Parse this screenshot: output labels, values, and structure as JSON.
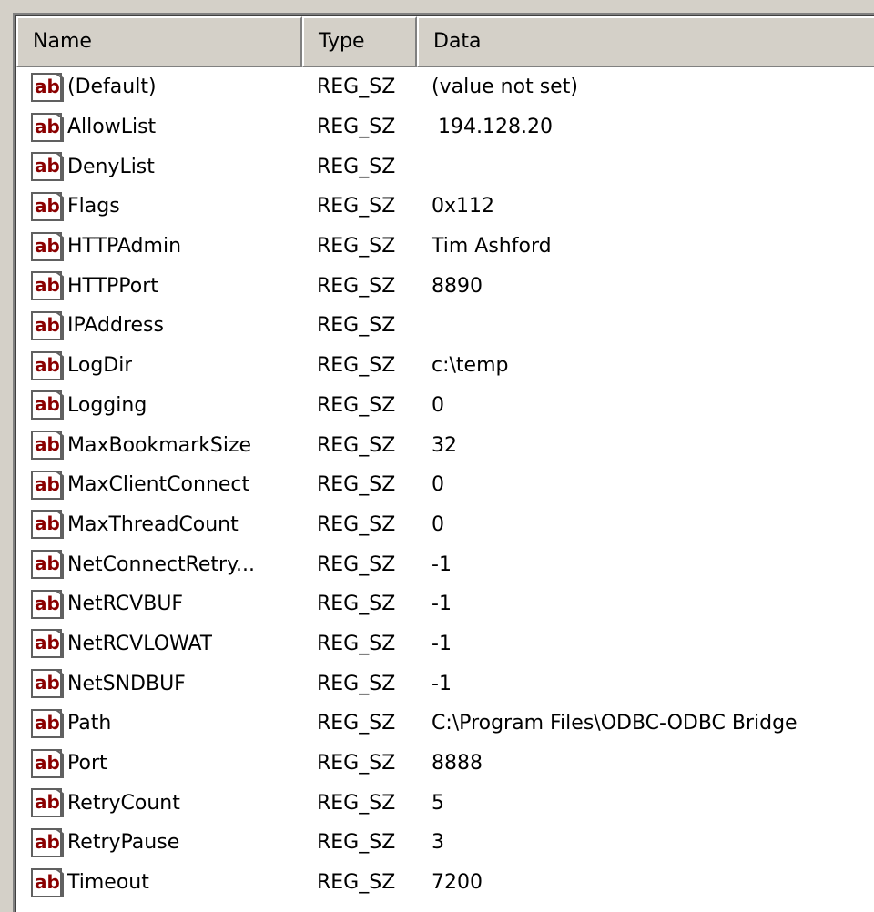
{
  "columns": {
    "name": "Name",
    "type": "Type",
    "data": "Data"
  },
  "icon": "string-value-ab-icon",
  "colors": {
    "icon_text": "#8b0000",
    "icon_border": "#606060",
    "header_bg": "#d4d0c8"
  },
  "rows": [
    {
      "name": "(Default)",
      "type": "REG_SZ",
      "data": "(value not set)"
    },
    {
      "name": "AllowList",
      "type": "REG_SZ",
      "data": " 194.128.20"
    },
    {
      "name": "DenyList",
      "type": "REG_SZ",
      "data": ""
    },
    {
      "name": "Flags",
      "type": "REG_SZ",
      "data": "0x112"
    },
    {
      "name": "HTTPAdmin",
      "type": "REG_SZ",
      "data": "Tim Ashford"
    },
    {
      "name": "HTTPPort",
      "type": "REG_SZ",
      "data": "8890"
    },
    {
      "name": "IPAddress",
      "type": "REG_SZ",
      "data": ""
    },
    {
      "name": "LogDir",
      "type": "REG_SZ",
      "data": "c:\\temp"
    },
    {
      "name": "Logging",
      "type": "REG_SZ",
      "data": "0"
    },
    {
      "name": "MaxBookmarkSize",
      "type": "REG_SZ",
      "data": "32"
    },
    {
      "name": "MaxClientConnect",
      "type": "REG_SZ",
      "data": "0"
    },
    {
      "name": "MaxThreadCount",
      "type": "REG_SZ",
      "data": "0"
    },
    {
      "name": "NetConnectRetry...",
      "type": "REG_SZ",
      "data": "-1"
    },
    {
      "name": "NetRCVBUF",
      "type": "REG_SZ",
      "data": "-1"
    },
    {
      "name": "NetRCVLOWAT",
      "type": "REG_SZ",
      "data": "-1"
    },
    {
      "name": "NetSNDBUF",
      "type": "REG_SZ",
      "data": "-1"
    },
    {
      "name": "Path",
      "type": "REG_SZ",
      "data": "C:\\Program Files\\ODBC-ODBC Bridge"
    },
    {
      "name": "Port",
      "type": "REG_SZ",
      "data": "8888"
    },
    {
      "name": "RetryCount",
      "type": "REG_SZ",
      "data": "5"
    },
    {
      "name": "RetryPause",
      "type": "REG_SZ",
      "data": "3"
    },
    {
      "name": "Timeout",
      "type": "REG_SZ",
      "data": "7200"
    }
  ]
}
